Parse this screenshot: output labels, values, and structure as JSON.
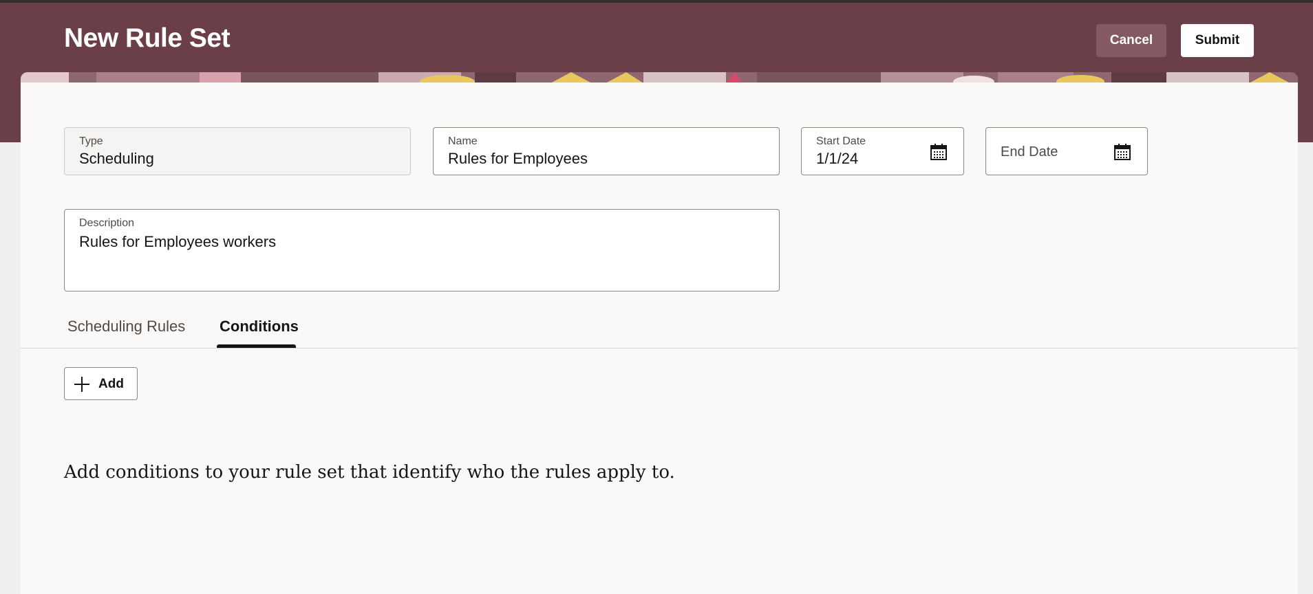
{
  "header": {
    "title": "New Rule Set",
    "cancel_label": "Cancel",
    "submit_label": "Submit",
    "background_color": "#6b3f48"
  },
  "form": {
    "type": {
      "label": "Type",
      "value": "Scheduling",
      "readonly": true
    },
    "name": {
      "label": "Name",
      "value": "Rules for Employees"
    },
    "start_date": {
      "label": "Start Date",
      "value": "1/1/24",
      "icon": "calendar-icon"
    },
    "end_date": {
      "placeholder": "End Date",
      "icon": "calendar-icon"
    },
    "description": {
      "label": "Description",
      "value": "Rules for Employees workers"
    }
  },
  "tabs": [
    {
      "label": "Scheduling Rules",
      "active": false
    },
    {
      "label": "Conditions",
      "active": true
    }
  ],
  "conditions": {
    "add_label": "Add",
    "add_icon": "plus-icon",
    "empty_message": "Add conditions to your rule set that identify who the rules apply to."
  },
  "colors": {
    "accent": "#161513",
    "sheet": "#faf9f8",
    "page": "#f1efed"
  }
}
